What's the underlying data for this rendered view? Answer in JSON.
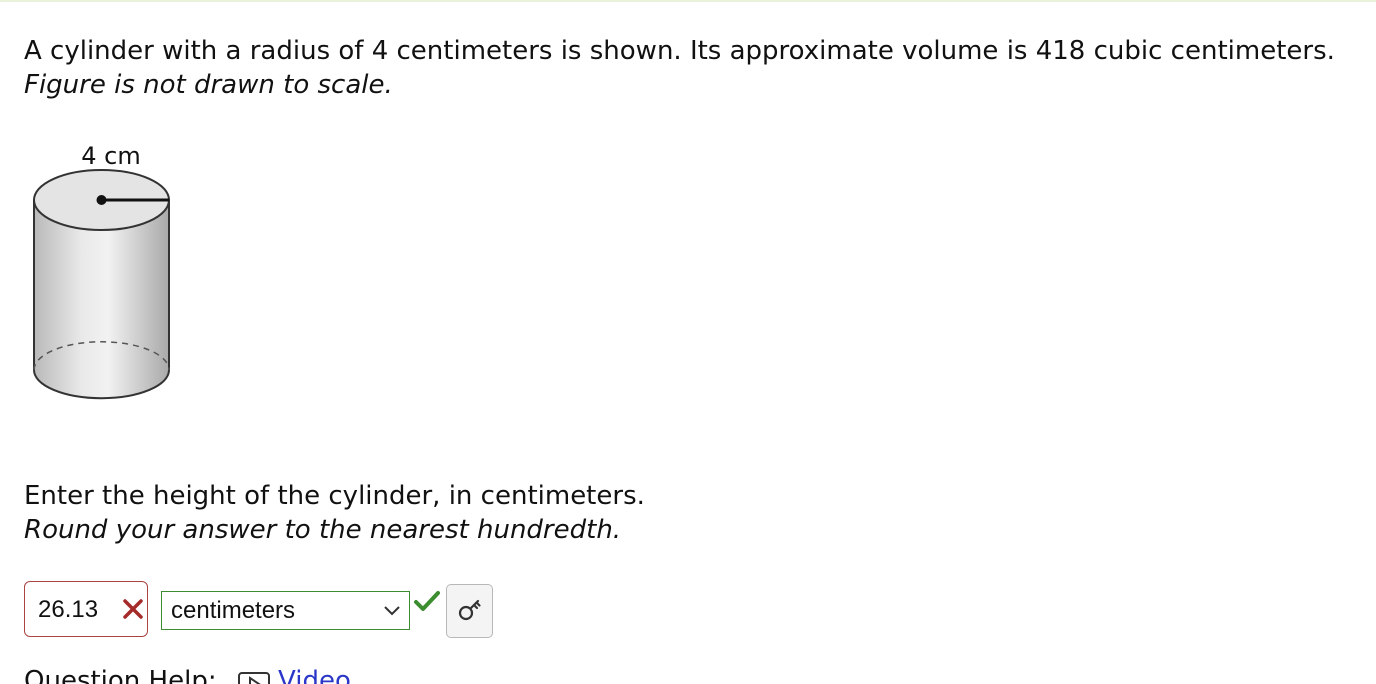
{
  "question": {
    "line1": "A cylinder with a radius of 4 centimeters is shown. Its approximate volume is 418 cubic centimeters.",
    "line2": "Figure is not drawn to scale."
  },
  "figure": {
    "radius_label": "4 cm"
  },
  "prompt": {
    "line1": "Enter the height of the cylinder, in centimeters.",
    "line2": "Round your answer to the nearest hundredth."
  },
  "answer": {
    "value": "26.13",
    "status": "incorrect",
    "status_color": "#a52a2a"
  },
  "unit_select": {
    "selected": "centimeters",
    "status": "correct",
    "status_color": "#3c8d2f"
  },
  "help": {
    "label": "Question Help:",
    "video_label": "Video",
    "link_color": "#2b37c9"
  },
  "icons": {
    "incorrect": "x-mark-icon",
    "correct": "check-mark-icon",
    "key": "key-icon",
    "video": "video-icon",
    "dropdown": "chevron-down-icon"
  }
}
